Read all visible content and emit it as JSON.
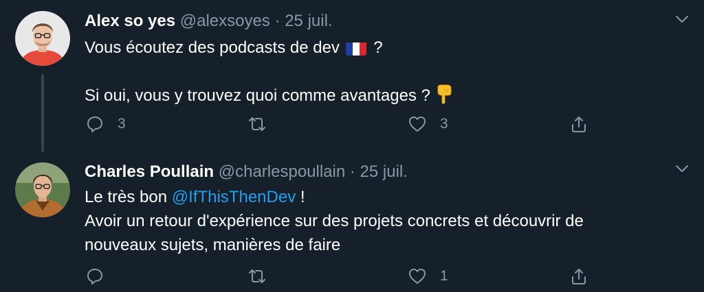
{
  "tweets": [
    {
      "display_name": "Alex so yes",
      "handle": "@alexsoyes",
      "separator": "·",
      "date": "25 juil.",
      "line1_before_flag": "Vous écoutez des podcasts de dev",
      "flag_icon": "france-flag-emoji",
      "line1_after_flag": "?",
      "line3_text": "Si oui, vous y trouvez quoi comme avantages ?",
      "pointing_icon": "backhand-index-pointing-down-emoji",
      "reply_count": "3",
      "retweet_count": "",
      "like_count": "3"
    },
    {
      "display_name": "Charles Poullain",
      "handle": "@charlespoullain",
      "separator": "·",
      "date": "25 juil.",
      "line1_prefix": "Le très bon",
      "mention": "@IfThisThenDev",
      "line1_suffix": "!",
      "line2": "Avoir un retour d'expérience sur des projets concrets et découvrir de",
      "line3": "nouveaux sujets, manières de faire",
      "reply_count": "",
      "retweet_count": "",
      "like_count": "1"
    }
  ],
  "colors": {
    "background": "#15202b",
    "primary_text": "#ffffff",
    "secondary_text": "#8899a6",
    "link": "#1da1f2",
    "thread_line": "#38444d"
  }
}
